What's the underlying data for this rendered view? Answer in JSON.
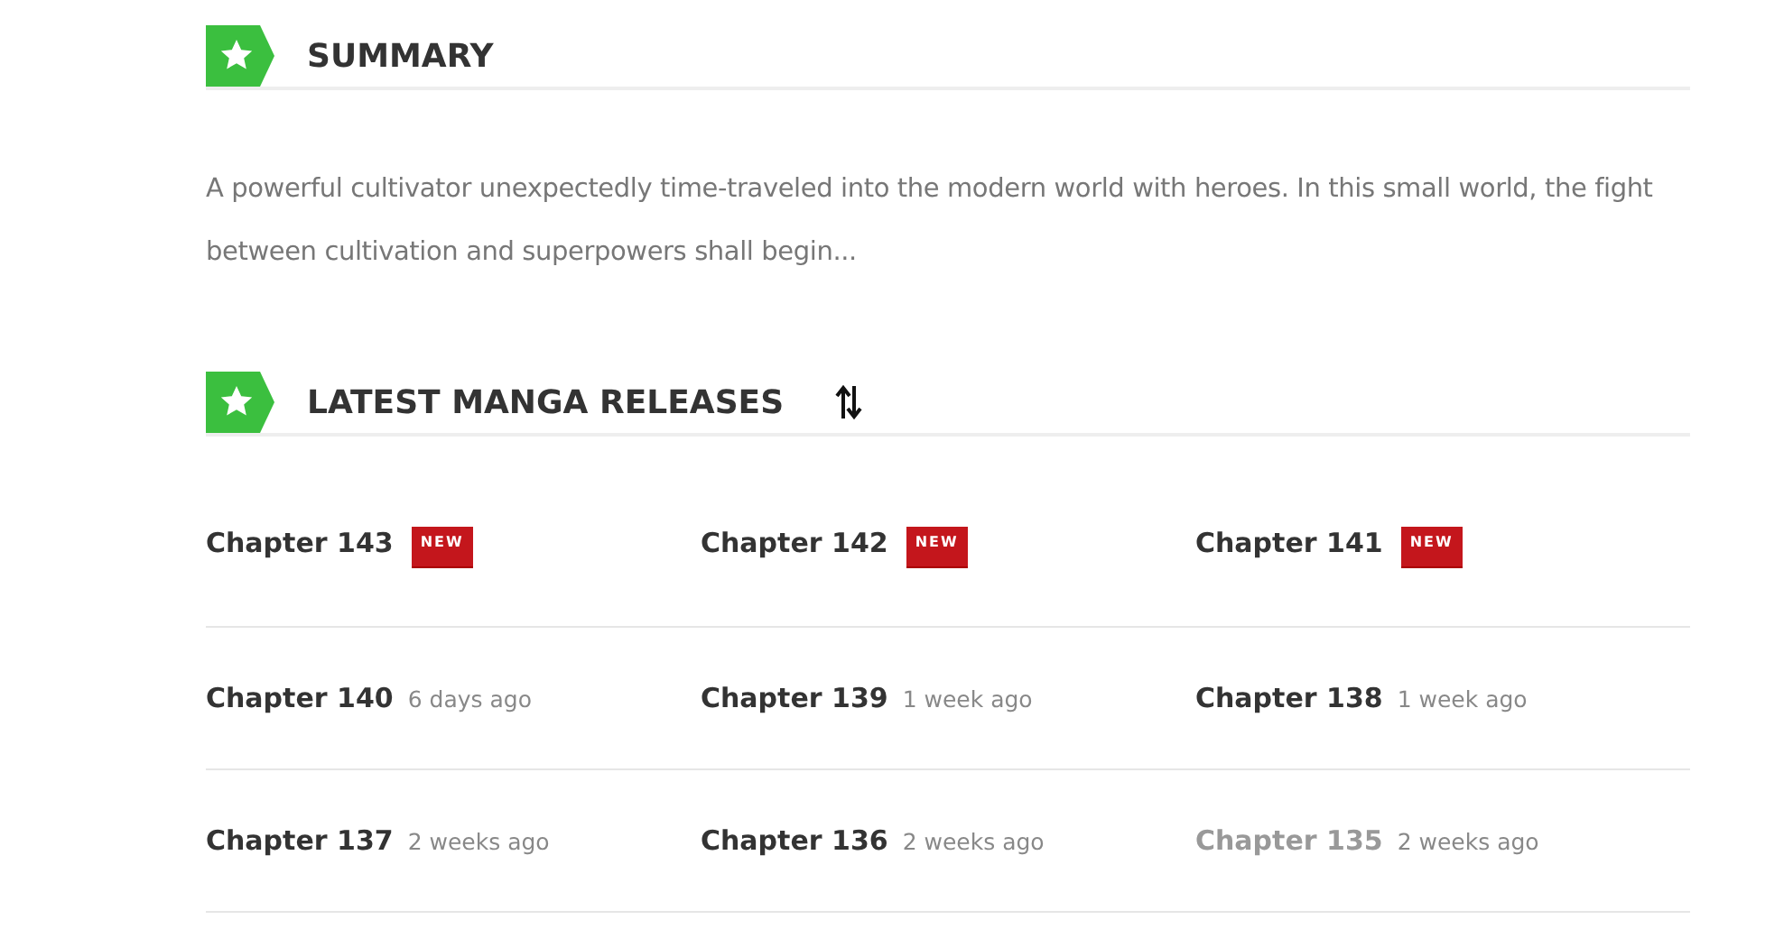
{
  "summary": {
    "title": "SUMMARY",
    "text": "A powerful cultivator unexpectedly time-traveled into the modern world with heroes. In this small world, the fight between cultivation and superpowers shall begin..."
  },
  "releases": {
    "title": "LATEST MANGA RELEASES",
    "chapters": [
      {
        "title": "Chapter 143",
        "kind": "new",
        "badge": "NEW",
        "visited": false
      },
      {
        "title": "Chapter 142",
        "kind": "new",
        "badge": "NEW",
        "visited": false
      },
      {
        "title": "Chapter 141",
        "kind": "new",
        "badge": "NEW",
        "visited": false
      },
      {
        "title": "Chapter 140",
        "kind": "dated",
        "time": "6 days ago",
        "visited": false
      },
      {
        "title": "Chapter 139",
        "kind": "dated",
        "time": "1 week ago",
        "visited": false
      },
      {
        "title": "Chapter 138",
        "kind": "dated",
        "time": "1 week ago",
        "visited": false
      },
      {
        "title": "Chapter 137",
        "kind": "dated",
        "time": "2 weeks ago",
        "visited": false
      },
      {
        "title": "Chapter 136",
        "kind": "dated",
        "time": "2 weeks ago",
        "visited": false
      },
      {
        "title": "Chapter 135",
        "kind": "dated",
        "time": "2 weeks ago",
        "visited": true
      }
    ]
  }
}
